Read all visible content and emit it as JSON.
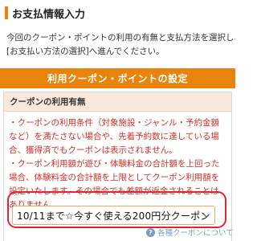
{
  "header": {
    "title": "お支払情報入力"
  },
  "intro": {
    "line1": "今回のクーポン・ポイントの利用の有無と支払方法を選択し、",
    "line2": "[お支払い方法の選択]へ進んでください。"
  },
  "settings_band": {
    "label": "利用クーポン・ポイントの設定"
  },
  "coupon_card": {
    "heading": "クーポンの利用有無",
    "notes": [
      "・クーポンの利用条件（対象施設・ジャンル・予約金額",
      "など）を満たさない場合や、先着予約数に達している場",
      "合、獲得済でもクーポンは表示されません。",
      "・クーポン利用額が遊び・体験料金の合計額を上回った",
      "場合、体験料金の合計額を上限としてクーポン利用額を",
      "設定いたします。その場合でも差額が返金されることは",
      "ありません。"
    ],
    "select_value": "10/11まで☆今すぐ使える200円分クーポン",
    "chevron_icon": "chevron-down-icon"
  },
  "help_link": {
    "icon": "question-circle-icon",
    "label": "各種クーポンについて"
  },
  "colors": {
    "accent_orange": "#e8830c",
    "note_red": "#d03027",
    "highlight_red": "#e0262e",
    "card_head_bg": "#fbe8dc",
    "link_blue": "#7a9cc2"
  }
}
